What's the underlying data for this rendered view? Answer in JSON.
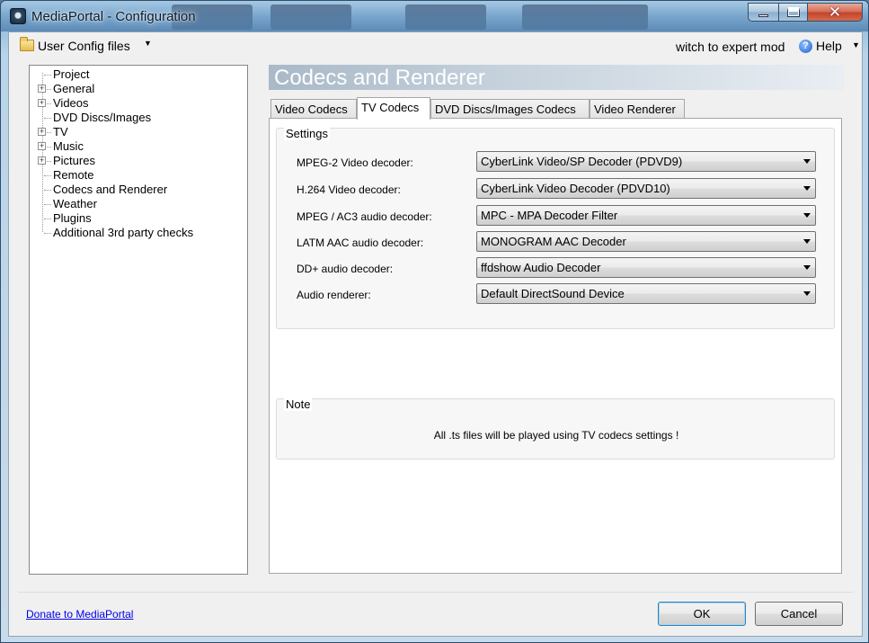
{
  "window": {
    "title": "MediaPortal - Configuration"
  },
  "toolbar": {
    "config_files_label": "User Config files",
    "expert_mode_label": "witch to expert mod",
    "help_label": "Help"
  },
  "tree": {
    "items": [
      {
        "label": "Project",
        "expandable": false
      },
      {
        "label": "General",
        "expandable": true
      },
      {
        "label": "Videos",
        "expandable": true
      },
      {
        "label": "DVD Discs/Images",
        "expandable": false
      },
      {
        "label": "TV",
        "expandable": true
      },
      {
        "label": "Music",
        "expandable": true
      },
      {
        "label": "Pictures",
        "expandable": true
      },
      {
        "label": "Remote",
        "expandable": false
      },
      {
        "label": "Codecs and Renderer",
        "expandable": false,
        "selected": true
      },
      {
        "label": "Weather",
        "expandable": false
      },
      {
        "label": "Plugins",
        "expandable": false
      },
      {
        "label": "Additional 3rd party checks",
        "expandable": false
      }
    ]
  },
  "pane": {
    "title": "Codecs and Renderer",
    "tabs": [
      {
        "label": "Video Codecs"
      },
      {
        "label": "TV Codecs",
        "active": true
      },
      {
        "label": "DVD Discs/Images Codecs"
      },
      {
        "label": "Video Renderer"
      }
    ],
    "settings": {
      "title": "Settings",
      "rows": [
        {
          "label": "MPEG-2 Video decoder:",
          "value": "CyberLink Video/SP Decoder (PDVD9)"
        },
        {
          "label": "H.264 Video decoder:",
          "value": "CyberLink Video Decoder (PDVD10)"
        },
        {
          "label": "MPEG / AC3 audio decoder:",
          "value": "MPC - MPA Decoder Filter"
        },
        {
          "label": "LATM AAC audio decoder:",
          "value": "MONOGRAM AAC Decoder"
        },
        {
          "label": "DD+ audio decoder:",
          "value": "ffdshow Audio Decoder"
        },
        {
          "label": "Audio renderer:",
          "value": "Default DirectSound Device"
        }
      ]
    },
    "note": {
      "title": "Note",
      "text": "All .ts files will be played using TV codecs settings !"
    }
  },
  "footer": {
    "donate_link": "Donate to MediaPortal",
    "ok_label": "OK",
    "cancel_label": "Cancel"
  }
}
